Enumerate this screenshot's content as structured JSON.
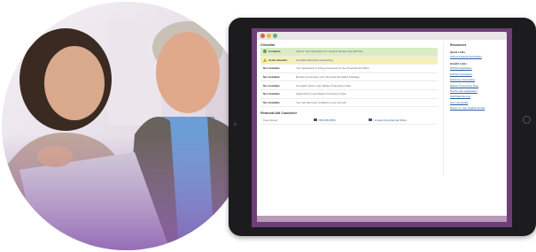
{
  "checklist": {
    "title": "Checklist",
    "rows": [
      {
        "status": "Complete",
        "kind": "complete",
        "text": "Submit Your Application for Federal Student Aid (FAFSA)",
        "link": false
      },
      {
        "status": "Action Needed",
        "kind": "action",
        "text": "Complete Entrance Counseling",
        "link": true
      },
      {
        "status": "Not Available",
        "kind": "na",
        "text": "Your application is being processed by the Financial Aid Office",
        "link": false
      },
      {
        "status": "Not Available",
        "kind": "na",
        "text": "Review and Accept your Financial Aid Award Package",
        "link": false
      },
      {
        "status": "Not Available",
        "kind": "na",
        "text": "Complete Direct Loan Master Promissory Note",
        "link": false
      },
      {
        "status": "Not Available",
        "kind": "na",
        "text": "Apply Direct Loan Master Promissory Note",
        "link": false
      },
      {
        "status": "Not Available",
        "kind": "na",
        "text": "Your aid has been credited to your account",
        "link": false
      }
    ]
  },
  "financial_aid": {
    "title": "Financial Aid Counselor",
    "row_label": "Team Name",
    "phone": "555-555-5555",
    "contact_link": "Contact Financial Aid Office"
  },
  "resources": {
    "title": "Resources",
    "quick_links_title": "Quick Links",
    "quick_links": [
      "Submit Federal Verification"
    ],
    "helpful_links_title": "Helpful Links",
    "helpful_links": [
      "FAFSA Application",
      "FAFSA Verification",
      "Entrance Counseling",
      "Master Promissory Note",
      "PLUS Loan Application",
      "SAP/Self-Service",
      "Get Connected",
      "Return to Your Student Portal"
    ]
  }
}
